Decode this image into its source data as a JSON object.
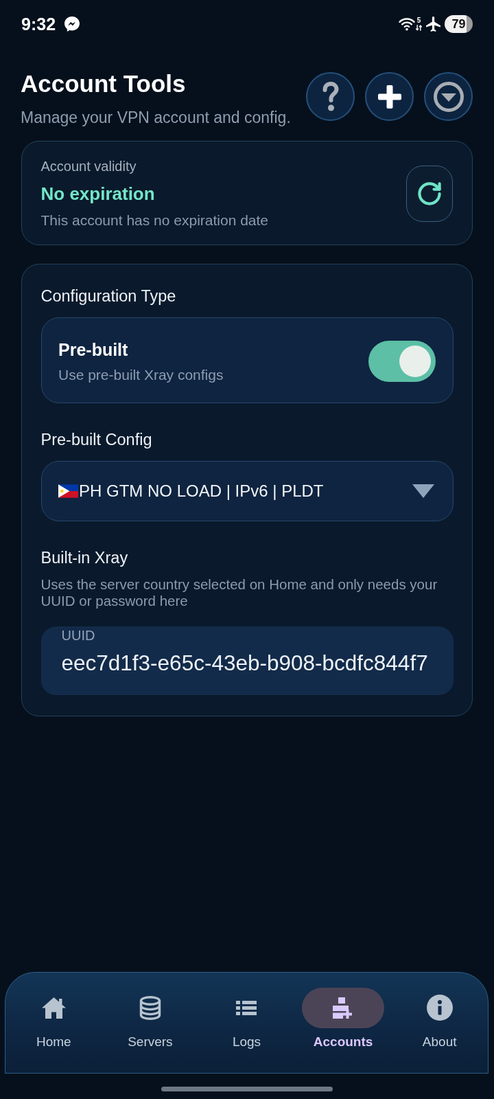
{
  "status_bar": {
    "time": "9:32",
    "wifi_band": "5",
    "battery": "79"
  },
  "header": {
    "title": "Account Tools",
    "subtitle": "Manage your VPN account and config."
  },
  "validity_card": {
    "label": "Account validity",
    "status": "No expiration",
    "note": "This account has no expiration date"
  },
  "config_card": {
    "heading": "Configuration Type",
    "option": {
      "title": "Pre-built",
      "description": "Use pre-built Xray configs",
      "on": true
    },
    "select": {
      "label": "Pre-built Config",
      "value": "PH GTM NO LOAD | IPv6 | PLDT"
    },
    "xray": {
      "heading": "Built-in Xray",
      "description": "Uses the server country selected on Home and only needs your UUID or password here",
      "field": {
        "label": "UUID",
        "value": "eec7d1f3-e65c-43eb-b908-bcdfc844f7"
      }
    }
  },
  "nav": [
    {
      "label": "Home",
      "selected": false
    },
    {
      "label": "Servers",
      "selected": false
    },
    {
      "label": "Logs",
      "selected": false
    },
    {
      "label": "Accounts",
      "selected": true
    },
    {
      "label": "About",
      "selected": false
    }
  ]
}
